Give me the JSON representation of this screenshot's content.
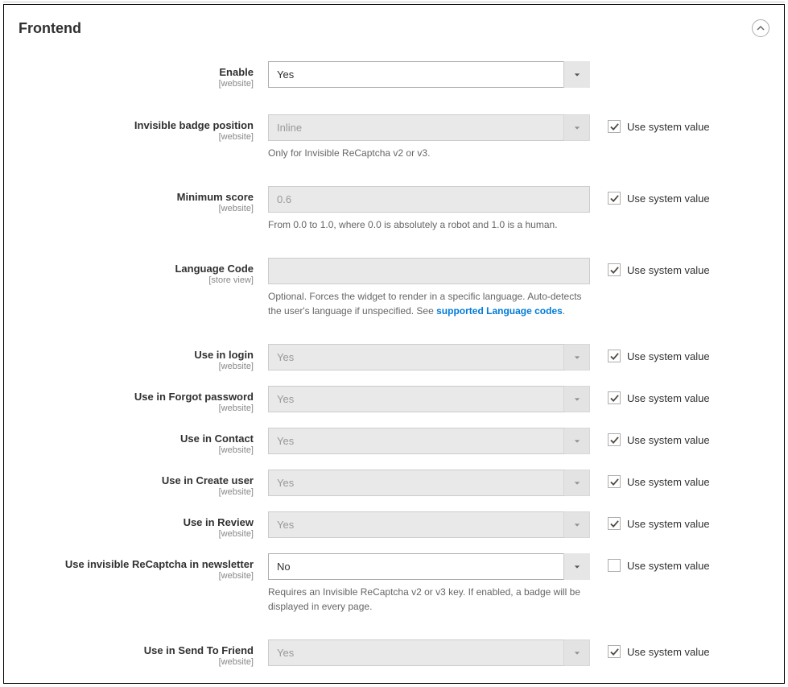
{
  "section": {
    "title": "Frontend",
    "use_system_label": "Use system value",
    "fields": {
      "enable": {
        "label": "Enable",
        "scope": "[website]",
        "value": "Yes",
        "disabled": false,
        "has_checkbox": false
      },
      "badge_position": {
        "label": "Invisible badge position",
        "scope": "[website]",
        "value": "Inline",
        "disabled": true,
        "checked": true,
        "note": "Only for Invisible ReCaptcha v2 or v3."
      },
      "min_score": {
        "label": "Minimum score",
        "scope": "[website]",
        "value": "0.6",
        "type": "text",
        "disabled": true,
        "checked": true,
        "note": "From 0.0 to 1.0, where 0.0 is absolutely a robot and 1.0 is a human."
      },
      "language": {
        "label": "Language Code",
        "scope": "[store view]",
        "value": "",
        "type": "text",
        "disabled": true,
        "checked": true,
        "note_pre": "Optional. Forces the widget to render in a specific language. Auto-detects the user's language if unspecified. See ",
        "note_link": "supported Language codes",
        "note_post": "."
      },
      "login": {
        "label": "Use in login",
        "scope": "[website]",
        "value": "Yes",
        "disabled": true,
        "checked": true
      },
      "forgot": {
        "label": "Use in Forgot password",
        "scope": "[website]",
        "value": "Yes",
        "disabled": true,
        "checked": true
      },
      "contact": {
        "label": "Use in Contact",
        "scope": "[website]",
        "value": "Yes",
        "disabled": true,
        "checked": true
      },
      "create": {
        "label": "Use in Create user",
        "scope": "[website]",
        "value": "Yes",
        "disabled": true,
        "checked": true
      },
      "review": {
        "label": "Use in Review",
        "scope": "[website]",
        "value": "Yes",
        "disabled": true,
        "checked": true
      },
      "newsletter": {
        "label": "Use invisible ReCaptcha in newsletter",
        "scope": "[website]",
        "value": "No",
        "disabled": false,
        "checked": false,
        "note": "Requires an Invisible ReCaptcha v2 or v3 key. If enabled, a badge will be displayed in every page."
      },
      "send_friend": {
        "label": "Use in Send To Friend",
        "scope": "[website]",
        "value": "Yes",
        "disabled": true,
        "checked": true
      }
    }
  }
}
